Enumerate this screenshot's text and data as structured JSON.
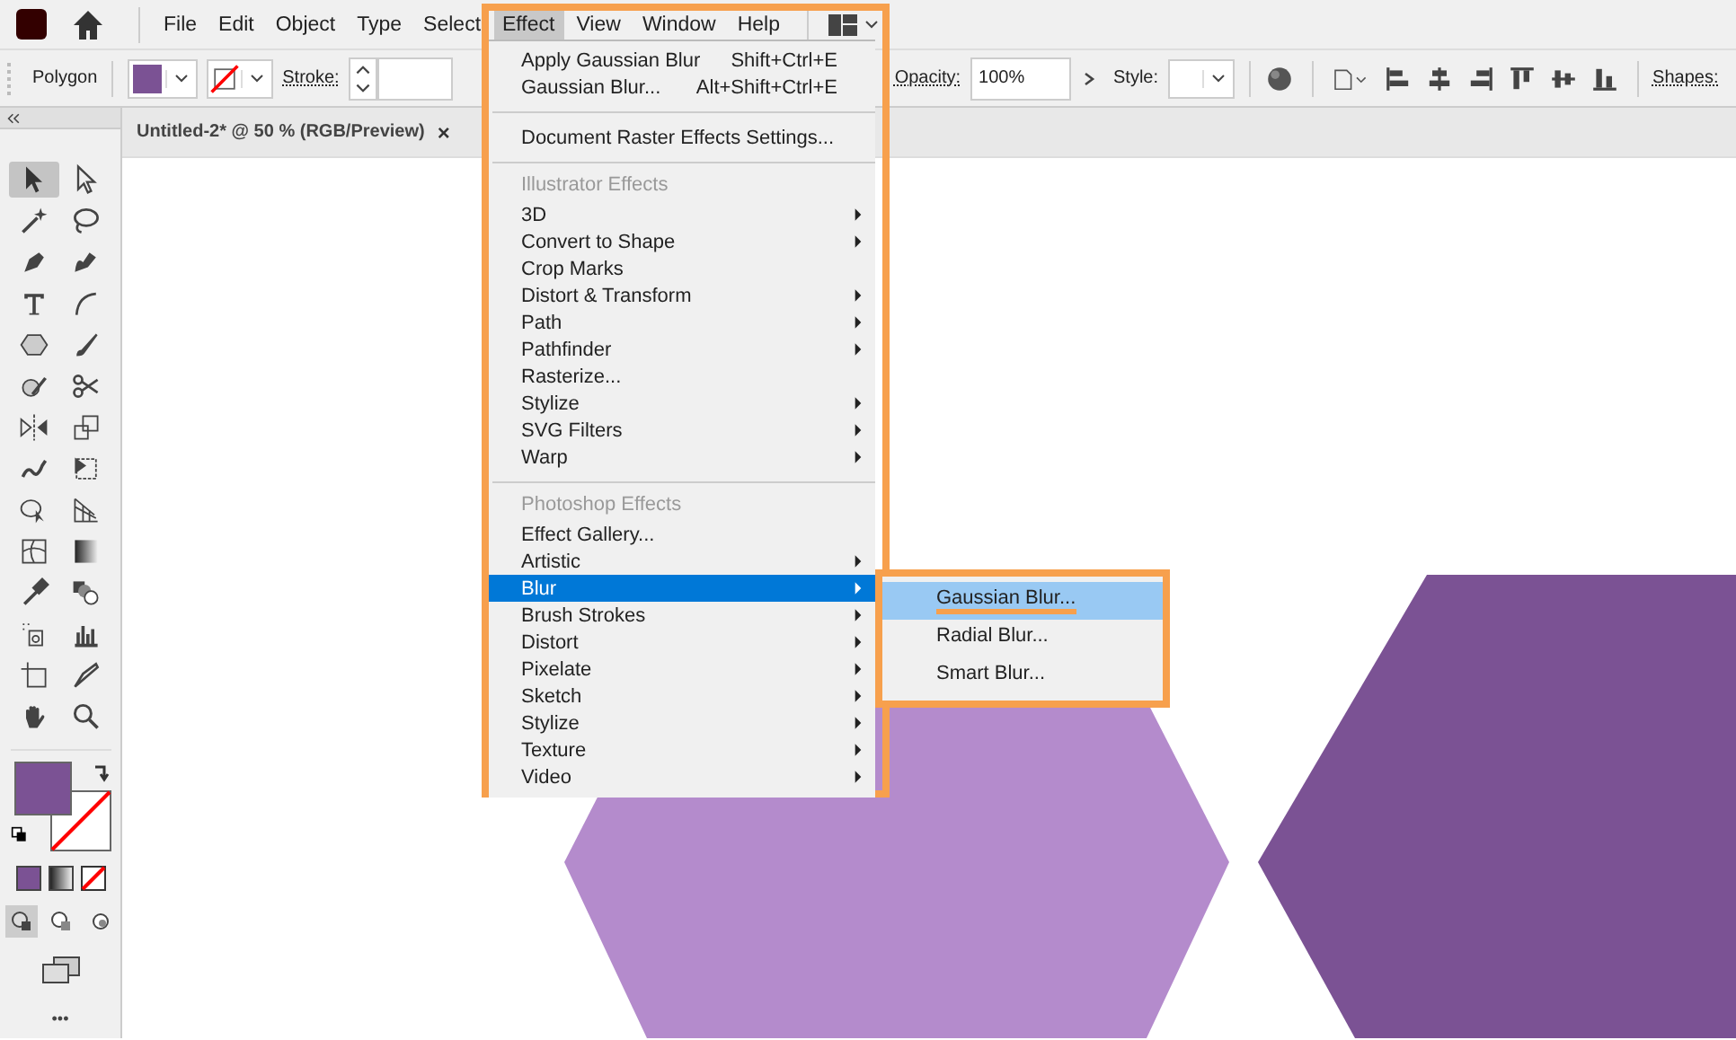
{
  "menu_bar": {
    "items": [
      {
        "label": "File",
        "selected": false
      },
      {
        "label": "Edit",
        "selected": false
      },
      {
        "label": "Object",
        "selected": false
      },
      {
        "label": "Type",
        "selected": false
      },
      {
        "label": "Select",
        "selected": false
      },
      {
        "label": "Effect",
        "selected": true
      },
      {
        "label": "View",
        "selected": false
      },
      {
        "label": "Window",
        "selected": false
      },
      {
        "label": "Help",
        "selected": false
      }
    ]
  },
  "control_bar": {
    "object_type": "Polygon",
    "stroke_label": "Stroke:",
    "opacity_label": "Opacity:",
    "opacity_value": "100%",
    "style_label": "Style:",
    "shapes_label": "Shapes:"
  },
  "document_tab": {
    "title": "Untitled-2* @ 50 % (RGB/Preview)",
    "close": "×"
  },
  "toolbox": {
    "tools": [
      {
        "kind": "selection",
        "selected": true
      },
      {
        "kind": "direct-selection",
        "selected": false
      },
      {
        "kind": "magic-wand",
        "selected": false
      },
      {
        "kind": "lasso",
        "selected": false
      },
      {
        "kind": "pen",
        "selected": false
      },
      {
        "kind": "curvature",
        "selected": false
      },
      {
        "kind": "type",
        "selected": false
      },
      {
        "kind": "arc",
        "selected": false
      },
      {
        "kind": "hexagon",
        "selected": false
      },
      {
        "kind": "brush",
        "selected": false
      },
      {
        "kind": "shaper",
        "selected": false
      },
      {
        "kind": "scissors",
        "selected": false
      },
      {
        "kind": "reflect",
        "selected": false
      },
      {
        "kind": "scale",
        "selected": false
      },
      {
        "kind": "warp",
        "selected": false
      },
      {
        "kind": "free-transform",
        "selected": false
      },
      {
        "kind": "shape-builder",
        "selected": false
      },
      {
        "kind": "perspective",
        "selected": false
      },
      {
        "kind": "mesh",
        "selected": false
      },
      {
        "kind": "gradient",
        "selected": false
      },
      {
        "kind": "eyedropper",
        "selected": false
      },
      {
        "kind": "blend",
        "selected": false
      },
      {
        "kind": "symbol-sprayer",
        "selected": false
      },
      {
        "kind": "graph",
        "selected": false
      },
      {
        "kind": "artboard",
        "selected": false
      },
      {
        "kind": "slice",
        "selected": false
      },
      {
        "kind": "hand",
        "selected": false
      },
      {
        "kind": "zoom",
        "selected": false
      }
    ],
    "more": "•••"
  },
  "effect_menu": {
    "annotated": true,
    "items": [
      {
        "kind": "item",
        "label": "Apply Gaussian Blur",
        "shortcut": "Shift+Ctrl+E",
        "submenu": false,
        "selected": false
      },
      {
        "kind": "item",
        "label": "Gaussian Blur...",
        "shortcut": "Alt+Shift+Ctrl+E",
        "submenu": false,
        "selected": false
      },
      {
        "kind": "separator"
      },
      {
        "kind": "item",
        "label": "Document Raster Effects Settings...",
        "submenu": false,
        "selected": false
      },
      {
        "kind": "separator"
      },
      {
        "kind": "header",
        "label": "Illustrator Effects"
      },
      {
        "kind": "item",
        "label": "3D",
        "submenu": true,
        "selected": false
      },
      {
        "kind": "item",
        "label": "Convert to Shape",
        "submenu": true,
        "selected": false
      },
      {
        "kind": "item",
        "label": "Crop Marks",
        "submenu": false,
        "selected": false
      },
      {
        "kind": "item",
        "label": "Distort & Transform",
        "submenu": true,
        "selected": false
      },
      {
        "kind": "item",
        "label": "Path",
        "submenu": true,
        "selected": false
      },
      {
        "kind": "item",
        "label": "Pathfinder",
        "submenu": true,
        "selected": false
      },
      {
        "kind": "item",
        "label": "Rasterize...",
        "submenu": false,
        "selected": false
      },
      {
        "kind": "item",
        "label": "Stylize",
        "submenu": true,
        "selected": false
      },
      {
        "kind": "item",
        "label": "SVG Filters",
        "submenu": true,
        "selected": false
      },
      {
        "kind": "item",
        "label": "Warp",
        "submenu": true,
        "selected": false
      },
      {
        "kind": "separator"
      },
      {
        "kind": "header",
        "label": "Photoshop Effects"
      },
      {
        "kind": "item",
        "label": "Effect Gallery...",
        "submenu": false,
        "selected": false
      },
      {
        "kind": "item",
        "label": "Artistic",
        "submenu": true,
        "selected": false
      },
      {
        "kind": "item",
        "label": "Blur",
        "submenu": true,
        "selected": true
      },
      {
        "kind": "item",
        "label": "Brush Strokes",
        "submenu": true,
        "selected": false
      },
      {
        "kind": "item",
        "label": "Distort",
        "submenu": true,
        "selected": false
      },
      {
        "kind": "item",
        "label": "Pixelate",
        "submenu": true,
        "selected": false
      },
      {
        "kind": "item",
        "label": "Sketch",
        "submenu": true,
        "selected": false
      },
      {
        "kind": "item",
        "label": "Stylize",
        "submenu": true,
        "selected": false
      },
      {
        "kind": "item",
        "label": "Texture",
        "submenu": true,
        "selected": false
      },
      {
        "kind": "item",
        "label": "Video",
        "submenu": true,
        "selected": false
      }
    ]
  },
  "blur_submenu": {
    "annotated": true,
    "items": [
      {
        "label": "Gaussian Blur...",
        "selected": true,
        "underlined": true
      },
      {
        "label": "Radial Blur...",
        "selected": false,
        "underlined": false
      },
      {
        "label": "Smart Blur...",
        "selected": false,
        "underlined": false
      }
    ]
  },
  "canvas": {
    "shapes": [
      {
        "kind": "hexagon",
        "color": "#b48bcc"
      },
      {
        "kind": "hexagon",
        "color": "#7b5294"
      }
    ]
  }
}
